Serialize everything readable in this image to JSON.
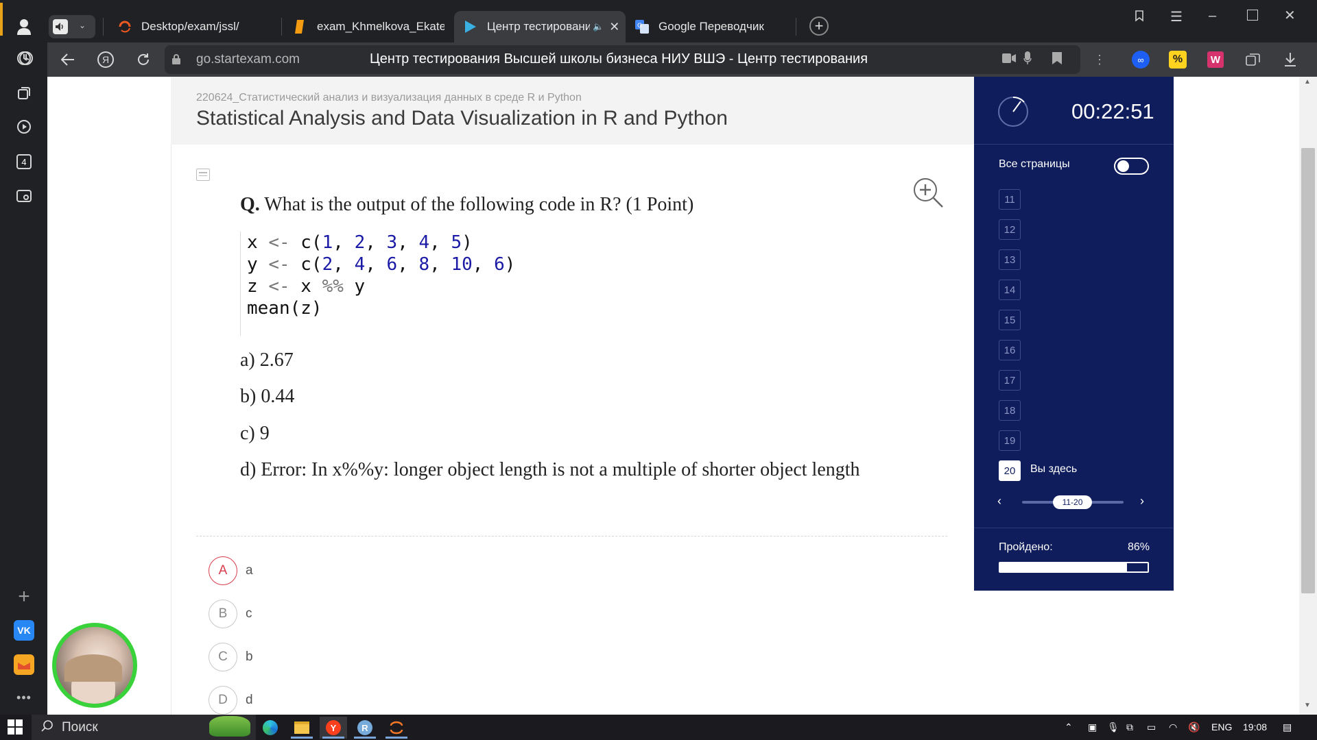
{
  "browser": {
    "tabs": [
      {
        "label": "Desktop/exam/jssl/",
        "icon": "loader-icon"
      },
      {
        "label": "exam_Khmelkova_Ekaterina",
        "icon": "document-icon"
      },
      {
        "label": "Центр тестирования",
        "icon": "play-icon",
        "active": true
      },
      {
        "label": "Google Переводчик",
        "icon": "translate-icon"
      }
    ],
    "address": "go.startexam.com",
    "page_title": "Центр тестирования Высшей школы бизнеса НИУ ВШЭ - Центр тестирования",
    "sidebar_badge": "4"
  },
  "exam": {
    "course_code": "220624_Статистический анализ и визуализация данных в среде R и Python",
    "course_title": "Statistical Analysis and Data Visualization in R and Python",
    "question": {
      "prefix": "Q.",
      "text": " What is the output of the following code in R? (1 Point)",
      "code": [
        {
          "parts": [
            {
              "t": "x ",
              "c": "p"
            },
            {
              "t": "<-",
              "c": "o"
            },
            {
              "t": " c(",
              "c": "p"
            },
            {
              "t": "1",
              "c": "n"
            },
            {
              "t": ", ",
              "c": "p"
            },
            {
              "t": "2",
              "c": "n"
            },
            {
              "t": ", ",
              "c": "p"
            },
            {
              "t": "3",
              "c": "n"
            },
            {
              "t": ", ",
              "c": "p"
            },
            {
              "t": "4",
              "c": "n"
            },
            {
              "t": ", ",
              "c": "p"
            },
            {
              "t": "5",
              "c": "n"
            },
            {
              "t": ")",
              "c": "p"
            }
          ]
        },
        {
          "parts": [
            {
              "t": "y ",
              "c": "p"
            },
            {
              "t": "<-",
              "c": "o"
            },
            {
              "t": " c(",
              "c": "p"
            },
            {
              "t": "2",
              "c": "n"
            },
            {
              "t": ", ",
              "c": "p"
            },
            {
              "t": "4",
              "c": "n"
            },
            {
              "t": ", ",
              "c": "p"
            },
            {
              "t": "6",
              "c": "n"
            },
            {
              "t": ", ",
              "c": "p"
            },
            {
              "t": "8",
              "c": "n"
            },
            {
              "t": ", ",
              "c": "p"
            },
            {
              "t": "10",
              "c": "n"
            },
            {
              "t": ", ",
              "c": "p"
            },
            {
              "t": "6",
              "c": "n"
            },
            {
              "t": ")",
              "c": "p"
            }
          ]
        },
        {
          "parts": [
            {
              "t": "z ",
              "c": "p"
            },
            {
              "t": "<-",
              "c": "o"
            },
            {
              "t": " x ",
              "c": "p"
            },
            {
              "t": "%%",
              "c": "o"
            },
            {
              "t": " y",
              "c": "p"
            }
          ]
        },
        {
          "parts": [
            {
              "t": "mean(z)",
              "c": "p"
            }
          ]
        }
      ],
      "options": [
        "a) 2.67",
        "b) 0.44",
        "c) 9",
        "d) Error: In x%%y: longer object length is not a multiple of shorter object length"
      ]
    },
    "answers": [
      {
        "letter": "A",
        "text": "a",
        "selected": true
      },
      {
        "letter": "B",
        "text": "c",
        "selected": false
      },
      {
        "letter": "C",
        "text": "b",
        "selected": false
      },
      {
        "letter": "D",
        "text": "d",
        "selected": false
      }
    ]
  },
  "panel": {
    "timer": "00:22:51",
    "all_pages_label": "Все страницы",
    "pages": [
      "11",
      "12",
      "13",
      "14",
      "15",
      "16",
      "17",
      "18",
      "19",
      "20"
    ],
    "current_page": "20",
    "current_label": "Вы здесь",
    "range_label": "11-20",
    "done_label": "Пройдено:",
    "done_value": "86%",
    "done_fraction": 0.86
  },
  "taskbar": {
    "search_placeholder": "Поиск",
    "language": "ENG",
    "time": "19:08"
  },
  "colors": {
    "panel_bg": "#0f1d5c",
    "selected_answer": "#d93c4b",
    "code_number": "#1a1aa6",
    "webcam_ring": "#3ad23a"
  }
}
